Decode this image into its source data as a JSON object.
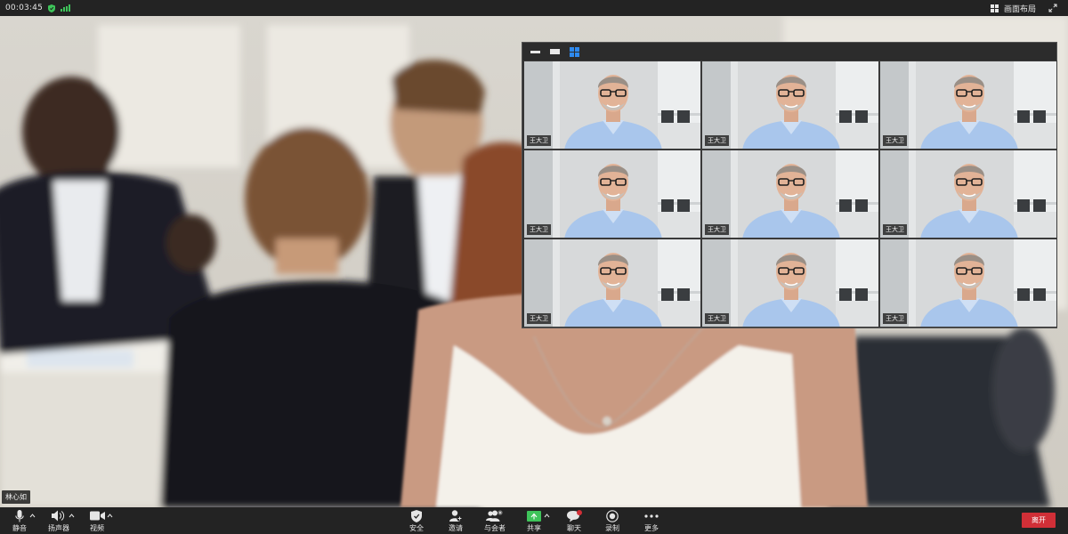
{
  "status_bar": {
    "timer": "00:03:45",
    "layout_label": "画面布局"
  },
  "self_name": "林心如",
  "gallery": {
    "tiles": [
      {
        "name": "王大卫"
      },
      {
        "name": "王大卫"
      },
      {
        "name": "王大卫"
      },
      {
        "name": "王大卫"
      },
      {
        "name": "王大卫"
      },
      {
        "name": "王大卫"
      },
      {
        "name": "王大卫"
      },
      {
        "name": "王大卫"
      },
      {
        "name": "王大卫"
      }
    ]
  },
  "toolbar": {
    "mute": "静音",
    "speaker": "扬声器",
    "video": "视频",
    "security": "安全",
    "invite": "邀请",
    "participants": "与会者",
    "share": "共享",
    "chat": "聊天",
    "record": "录制",
    "more": "更多",
    "leave": "离开"
  },
  "colors": {
    "accent_blue": "#2e8af0",
    "leave_red": "#d12f37",
    "secure_green": "#3ec45a",
    "toolbar_bg": "#232323"
  }
}
